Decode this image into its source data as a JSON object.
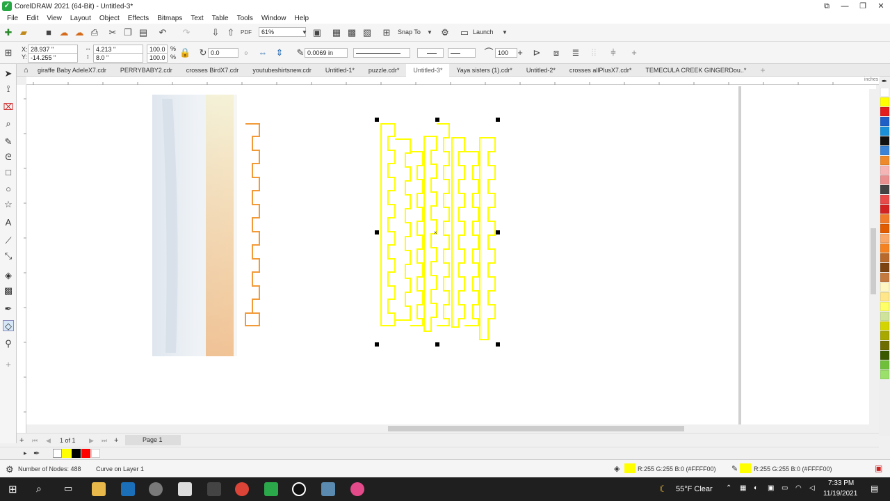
{
  "window": {
    "title": "CorelDRAW 2021 (64-Bit) - Untitled-3*"
  },
  "menu": [
    "File",
    "Edit",
    "View",
    "Layout",
    "Object",
    "Effects",
    "Bitmaps",
    "Text",
    "Table",
    "Tools",
    "Window",
    "Help"
  ],
  "toolbar": {
    "zoom_value": "61%",
    "snap_to_label": "Snap To",
    "launch_label": "Launch"
  },
  "properties": {
    "x_label": "X:",
    "x_value": "28.937 \"",
    "y_label": "Y:",
    "y_value": "-14.255 \"",
    "width_value": "4.213 \"",
    "height_value": "8.0 \"",
    "scale_w": "100.0",
    "scale_h": "100.0",
    "pct_w": "%",
    "pct_h": "%",
    "rotation": "0.0",
    "outline_width": "0.0069 in",
    "smoothing": "100"
  },
  "tabs": [
    {
      "label": "giraffe Baby AdeleX7.cdr"
    },
    {
      "label": "PERRYBABY2.cdr"
    },
    {
      "label": "crosses BirdX7.cdr"
    },
    {
      "label": "youtubeshirtsnew.cdr"
    },
    {
      "label": "Untitled-1*"
    },
    {
      "label": "puzzle.cdr*"
    },
    {
      "label": "Untitled-3*",
      "active": true
    },
    {
      "label": "Yaya sisters (1).cdr*"
    },
    {
      "label": "Untitled-2*"
    },
    {
      "label": "crosses allPlusX7.cdr*"
    },
    {
      "label": "TEMECULA CREEK GINGERDou..*"
    }
  ],
  "ruler_unit": "inches",
  "pagebar": {
    "page_count": "1 of 1",
    "page_tab": "Page 1"
  },
  "status": {
    "nodes": "Number of Nodes: 488",
    "object": "Curve on Layer 1",
    "fill_text": "R:255 G:255 B:0 (#FFFF00)",
    "outline_text": "R:255 G:255 B:0 (#FFFF00)"
  },
  "taskbar": {
    "weather": "55°F  Clear",
    "time": "7:33 PM",
    "date": "11/19/2021"
  },
  "colors": {
    "accent_yellow": "#FFFF00",
    "orange": "#F29A38"
  },
  "palette_colors": [
    "#ffffff",
    "#ffff00",
    "#e31c1c",
    "#1f5fc6",
    "#1a90d8",
    "#111111",
    "#3c85d6",
    "#ee8a2b",
    "#f6b4b4",
    "#e98f8f",
    "#444444",
    "#e84a4a",
    "#d32222",
    "#f07a2a",
    "#e15b00",
    "#f9a86a",
    "#f58220",
    "#b86a2c",
    "#7d4412",
    "#c47a3e",
    "#fff7c2",
    "#ffe68a",
    "#ffff66",
    "#cfe39a",
    "#d4d400",
    "#a8a800",
    "#6e6e00",
    "#3b5a00",
    "#6fbf3a",
    "#9be06a"
  ]
}
